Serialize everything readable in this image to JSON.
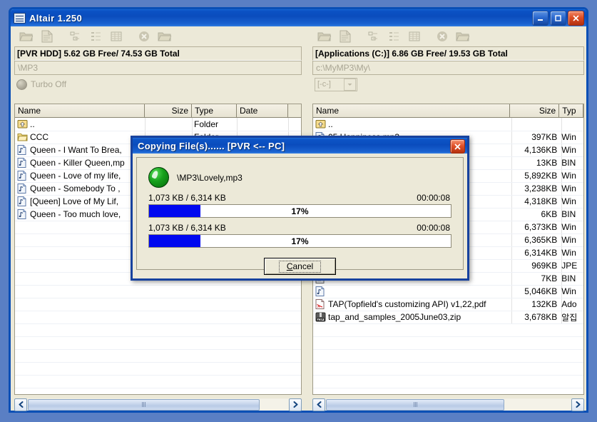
{
  "window": {
    "title": "Altair 1.250",
    "icon": "window-menu-icon",
    "buttons": {
      "minimize": "–",
      "maximize": "□",
      "close": "✕"
    }
  },
  "toolbar": {
    "items": [
      {
        "name": "open-folder-icon",
        "label": "Open Folder"
      },
      {
        "name": "new-file-icon",
        "label": "New File"
      },
      {
        "name": "sort-icon",
        "label": "Sort"
      },
      {
        "name": "list-view-icon",
        "label": "List View"
      },
      {
        "name": "detail-view-icon",
        "label": "Detail View"
      },
      {
        "name": "delete-icon",
        "label": "Delete"
      },
      {
        "name": "new-folder-icon",
        "label": "New Folder"
      }
    ]
  },
  "left_pane": {
    "disk_info": "[PVR HDD] 5.62 GB Free/ 74.53 GB Total",
    "path": "\\MP3",
    "turbo_label": "Turbo Off",
    "columns": [
      "Name",
      "Size",
      "Type",
      "Date"
    ],
    "rows": [
      {
        "icon": "up-folder-icon",
        "name": "..",
        "size": "",
        "type": "Folder",
        "date": ""
      },
      {
        "icon": "folder-icon",
        "name": "CCC",
        "size": "",
        "type": "Folder",
        "date": ""
      },
      {
        "icon": "mp3-file-icon",
        "name": "Queen - I Want To Brea,",
        "size": "",
        "type": "",
        "date": ""
      },
      {
        "icon": "mp3-file-icon",
        "name": "Queen - Killer Queen,mp",
        "size": "",
        "type": "",
        "date": ""
      },
      {
        "icon": "mp3-file-icon",
        "name": "Queen - Love of my life,",
        "size": "",
        "type": "",
        "date": ""
      },
      {
        "icon": "mp3-file-icon",
        "name": "Queen - Somebody To ,",
        "size": "",
        "type": "",
        "date": ""
      },
      {
        "icon": "mp3-file-icon",
        "name": "[Queen] Love of My Lif,",
        "size": "",
        "type": "",
        "date": ""
      },
      {
        "icon": "mp3-file-icon",
        "name": "Queen - Too much love,",
        "size": "",
        "type": "",
        "date": ""
      }
    ],
    "scrollbar": {
      "left_arrow": "◀",
      "right_arrow": "▶"
    }
  },
  "right_pane": {
    "disk_info": "[Applications (C:)] 6.86 GB Free/ 19.53 GB Total",
    "path": "c:\\MyMP3\\My\\",
    "drive_select": "[-c-]",
    "columns": [
      "Name",
      "Size",
      "Typ"
    ],
    "rows": [
      {
        "icon": "up-folder-icon",
        "name": "..",
        "size": "",
        "type": ""
      },
      {
        "icon": "mp3-file-icon",
        "name": "05,Happiness,mp3",
        "size": "397KB",
        "type": "Win"
      },
      {
        "icon": "mp3-file-icon",
        "name": "",
        "size": "4,136KB",
        "type": "Win"
      },
      {
        "icon": "bin-file-icon",
        "name": "",
        "size": "13KB",
        "type": "BIN"
      },
      {
        "icon": "mp3-file-icon",
        "name": "",
        "size": "5,892KB",
        "type": "Win"
      },
      {
        "icon": "mp3-file-icon",
        "name": "",
        "size": "3,238KB",
        "type": "Win"
      },
      {
        "icon": "mp3-file-icon",
        "name": "",
        "size": "4,318KB",
        "type": "Win"
      },
      {
        "icon": "bin-file-icon",
        "name": "",
        "size": "6KB",
        "type": "BIN"
      },
      {
        "icon": "mp3-file-icon",
        "name": "",
        "size": "6,373KB",
        "type": "Win"
      },
      {
        "icon": "mp3-file-icon",
        "name": "",
        "size": "6,365KB",
        "type": "Win"
      },
      {
        "icon": "mp3-file-icon",
        "name": "",
        "size": "6,314KB",
        "type": "Win"
      },
      {
        "icon": "jpeg-file-icon",
        "name": "",
        "size": "969KB",
        "type": "JPE"
      },
      {
        "icon": "bin-file-icon",
        "name": "",
        "size": "7KB",
        "type": "BIN"
      },
      {
        "icon": "mp3-file-icon",
        "name": "",
        "size": "5,046KB",
        "type": "Win"
      },
      {
        "icon": "pdf-file-icon",
        "name": "TAP(Topfield's customizing API) v1,22,pdf",
        "size": "132KB",
        "type": "Ado"
      },
      {
        "icon": "zip-file-icon",
        "name": "tap_and_samples_2005June03,zip",
        "size": "3,678KB",
        "type": "알집"
      }
    ],
    "scrollbar": {
      "left_arrow": "◀",
      "right_arrow": "▶"
    }
  },
  "dialog": {
    "title": "Copying File(s)......  [PVR <-- PC]",
    "close_label": "✕",
    "status_icon": "green-status-icon",
    "file_name": "\\MP3\\Lovely,mp3",
    "progress": [
      {
        "bytes": "1,073 KB / 6,314 KB",
        "time": "00:00:08",
        "percent_label": "17%",
        "percent": 17
      },
      {
        "bytes": "1,073 KB / 6,314 KB",
        "time": "00:00:08",
        "percent_label": "17%",
        "percent": 17
      }
    ],
    "cancel_label": "Cancel",
    "cancel_accel": "C",
    "bar_color": "#0008f0"
  }
}
